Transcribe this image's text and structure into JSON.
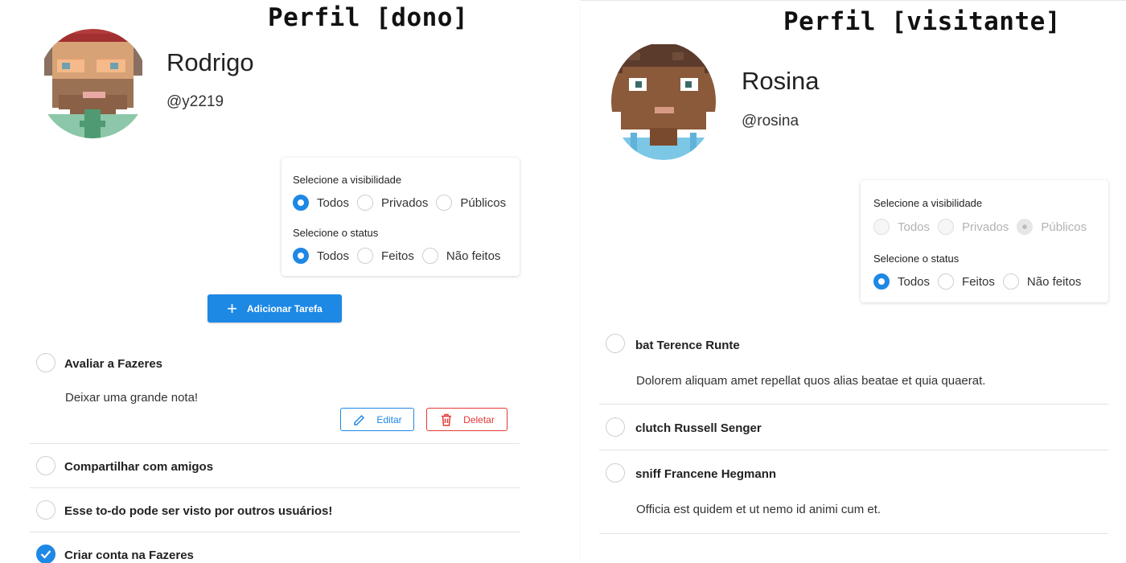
{
  "owner_panel": {
    "title": "Perfil [dono]",
    "user": {
      "name": "Rodrigo",
      "handle": "@y2219",
      "avatar_icon": "pixel-avatar-glasses-beard-icon"
    },
    "filters": {
      "visibility_label": "Selecione a visibilidade",
      "visibility_options": [
        "Todos",
        "Privados",
        "Públicos"
      ],
      "visibility_selected": "Todos",
      "status_label": "Selecione o status",
      "status_options": [
        "Todos",
        "Feitos",
        "Não feitos"
      ],
      "status_selected": "Todos"
    },
    "add_button": {
      "label": "Adicionar Tarefa",
      "icon": "plus-icon"
    },
    "tasks": [
      {
        "title": "Avaliar a Fazeres",
        "description": "Deixar uma grande nota!",
        "done": false,
        "edit_label": "Editar",
        "delete_label": "Deletar"
      },
      {
        "title": "Compartilhar com amigos",
        "done": false
      },
      {
        "title": "Esse to-do pode ser visto por outros usuários!",
        "done": false
      },
      {
        "title": "Criar conta na Fazeres",
        "done": true
      }
    ]
  },
  "visitor_panel": {
    "title": "Perfil [visitante]",
    "user": {
      "name": "Rosina",
      "handle": "@rosina",
      "avatar_icon": "pixel-avatar-dark-hair-icon"
    },
    "filters": {
      "visibility_label": "Selecione a visibilidade",
      "visibility_options": [
        "Todos",
        "Privados",
        "Públicos"
      ],
      "visibility_selected": "Públicos",
      "visibility_disabled": true,
      "status_label": "Selecione o status",
      "status_options": [
        "Todos",
        "Feitos",
        "Não feitos"
      ],
      "status_selected": "Todos"
    },
    "tasks": [
      {
        "title": "bat Terence Runte",
        "description": "Dolorem aliquam amet repellat quos alias beatae et quia quaerat.",
        "done": false
      },
      {
        "title": "clutch Russell Senger",
        "done": false
      },
      {
        "title": "sniff Francene Hegmann",
        "description": "Officia est quidem et ut nemo id animi cum et.",
        "done": false
      }
    ]
  },
  "colors": {
    "primary": "#1e88e5",
    "danger": "#e53935",
    "divider": "#e3e3e3"
  }
}
